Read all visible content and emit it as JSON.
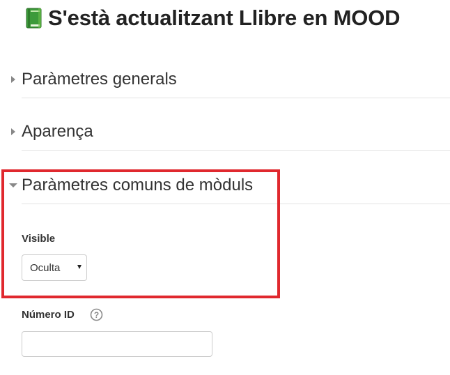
{
  "header": {
    "title": "S'està actualitzant Llibre en MOOD",
    "icon": "book-icon"
  },
  "sections": [
    {
      "label": "Paràmetres generals",
      "expanded": false
    },
    {
      "label": "Aparença",
      "expanded": false
    },
    {
      "label": "Paràmetres comuns de mòduls",
      "expanded": true
    }
  ],
  "form": {
    "visible": {
      "label": "Visible",
      "selected": "Oculta"
    },
    "id_number": {
      "label": "Número ID",
      "value": "",
      "help_icon": "question-circle-icon"
    }
  },
  "colors": {
    "highlight": "#e0282e",
    "text": "#333333",
    "book_green": "#3c9a3a"
  }
}
